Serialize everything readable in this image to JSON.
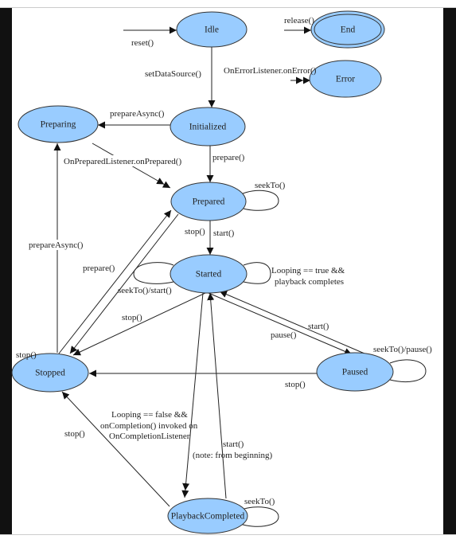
{
  "diagram": {
    "states": {
      "idle": "Idle",
      "end": "End",
      "error": "Error",
      "preparing": "Preparing",
      "initialized": "Initialized",
      "prepared": "Prepared",
      "started": "Started",
      "stopped": "Stopped",
      "paused": "Paused",
      "playback_completed": "PlaybackCompleted"
    },
    "transitions": {
      "reset": "reset()",
      "release": "release()",
      "on_error": "OnErrorListener.onError()",
      "set_data_source": "setDataSource()",
      "prepare_async_init": "prepareAsync()",
      "prepare_init": "prepare()",
      "on_prepared": "OnPreparedListener.onPrepared()",
      "seek_prepared": "seekTo()",
      "start_prepared": "start()",
      "stop_prepared": "stop()",
      "prepare_stopped": "prepare()",
      "prepare_async_stopped": "prepareAsync()",
      "seek_start_started": "seekTo()/start()",
      "looping_true_1": "Looping == true &&",
      "looping_true_2": "playback completes",
      "stop_started": "stop()",
      "start_paused": "start()",
      "pause_started": "pause()",
      "seek_pause_paused": "seekTo()/pause()",
      "stop_paused": "stop()",
      "stop_stopped": "stop()",
      "looping_false_1": "Looping == false &&",
      "looping_false_2": "onCompletion() invoked on",
      "looping_false_3": "OnCompletionListener",
      "start_completed_1": "start()",
      "start_completed_2": "(note: from beginning)",
      "stop_completed": "stop()",
      "seek_completed": "seekTo()"
    },
    "colors": {
      "state_fill": "#99ccff",
      "frame_border": "#111111"
    }
  }
}
